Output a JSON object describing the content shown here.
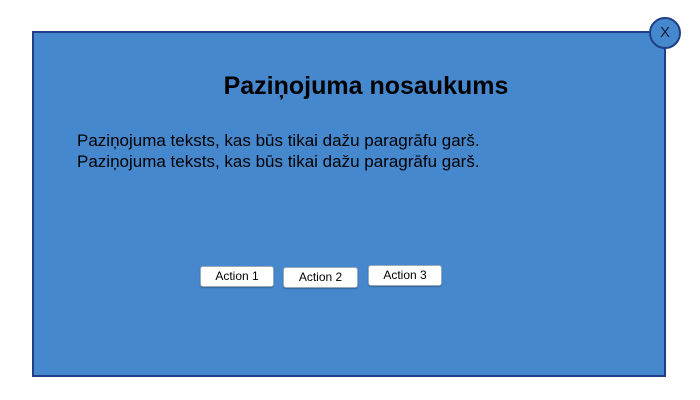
{
  "dialog": {
    "title": "Paziņojuma nosaukums",
    "body": "Paziņojuma teksts, kas būs tikai dažu paragrāfu garš. Paziņojuma teksts, kas būs tikai dažu paragrāfu garš.",
    "close_label": "X",
    "actions": [
      {
        "label": "Action 1"
      },
      {
        "label": "Action 2"
      },
      {
        "label": "Action 3"
      }
    ]
  },
  "colors": {
    "dialog_background": "#4688cd",
    "dialog_border": "#1f3f86",
    "button_background": "#ffffff"
  },
  "icons": {
    "close": "close-icon"
  }
}
